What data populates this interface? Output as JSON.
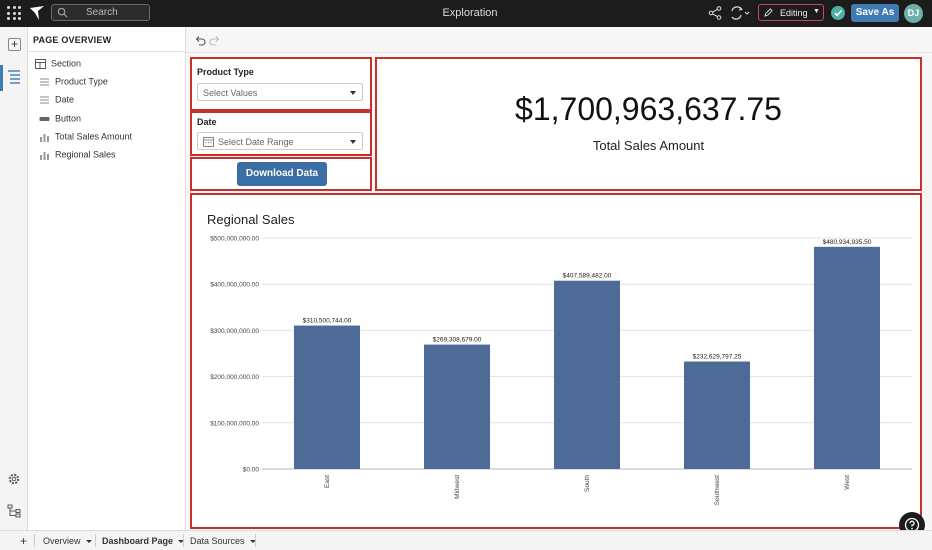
{
  "topbar": {
    "search_placeholder": "Search",
    "title": "Exploration",
    "mode_label": "Editing",
    "save_as_label": "Save As",
    "avatar_initials": "DJ"
  },
  "outline": {
    "title": "PAGE OVERVIEW",
    "items": [
      {
        "label": "Section",
        "icon": "section-icon"
      },
      {
        "label": "Product Type",
        "icon": "list-control-icon"
      },
      {
        "label": "Date",
        "icon": "list-control-icon"
      },
      {
        "label": "Button",
        "icon": "button-icon"
      },
      {
        "label": "Total Sales Amount",
        "icon": "chart-icon"
      },
      {
        "label": "Regional Sales",
        "icon": "chart-icon"
      }
    ]
  },
  "controls": {
    "product_type": {
      "label": "Product Type",
      "placeholder": "Select Values"
    },
    "date": {
      "label": "Date",
      "placeholder": "Select Date Range"
    },
    "download_label": "Download Data"
  },
  "kpi": {
    "value": "$1,700,963,637.75",
    "label": "Total Sales Amount"
  },
  "chart_data": {
    "type": "bar",
    "title": "Regional Sales",
    "xlabel": "",
    "ylabel": "",
    "categories": [
      "East",
      "Midwest",
      "South",
      "Southwest",
      "West"
    ],
    "values": [
      310500744.0,
      269308679.0,
      407589482.0,
      232629797.25,
      480934935.5
    ],
    "value_labels": [
      "$310,500,744.00",
      "$269,308,679.00",
      "$407,589,482.00",
      "$232,629,797.25",
      "$480,934,935.50"
    ],
    "yticks": [
      0,
      100000000,
      200000000,
      300000000,
      400000000,
      500000000
    ],
    "ytick_labels": [
      "$0.00",
      "$100,000,000.00",
      "$200,000,000.00",
      "$300,000,000.00",
      "$400,000,000.00",
      "$500,000,000.00"
    ],
    "ylim": [
      0,
      500000000
    ],
    "grid": true,
    "legend": "none",
    "bar_color": "#4e6a97"
  },
  "tabs": [
    {
      "label": "Overview",
      "active": false
    },
    {
      "label": "Dashboard Page",
      "active": true
    },
    {
      "label": "Data Sources",
      "active": false
    }
  ],
  "colors": {
    "accent": "#3f7ab3",
    "highlight_frame": "#c9302c",
    "topbar": "#1c1c1c"
  }
}
